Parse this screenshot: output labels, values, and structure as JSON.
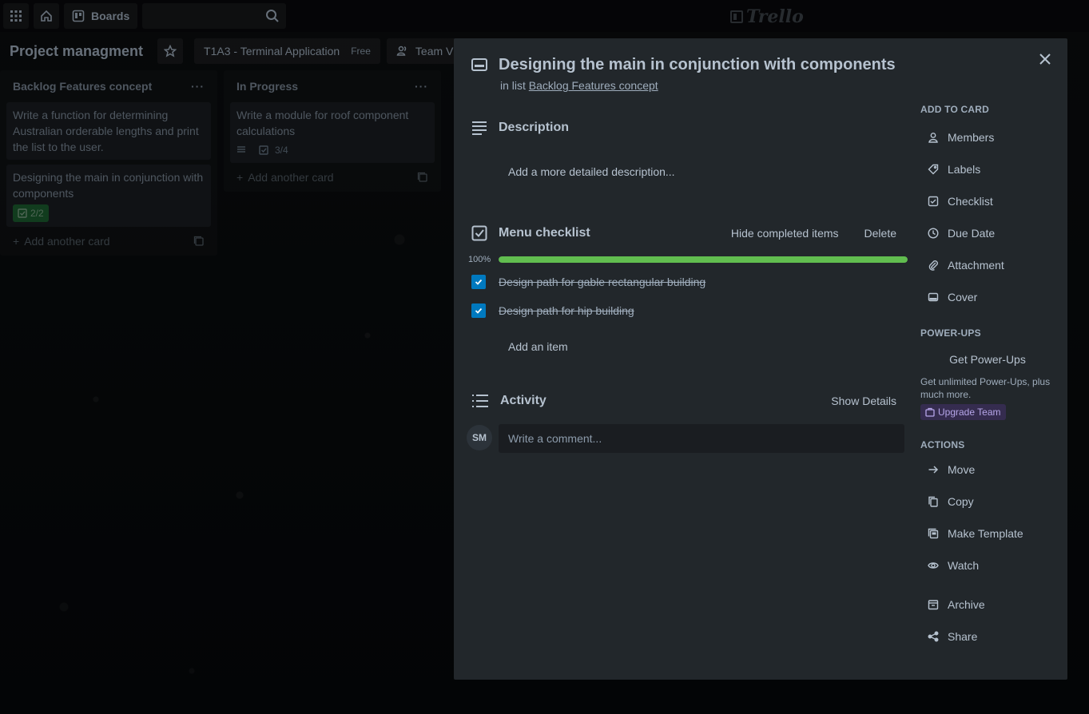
{
  "topbar": {
    "boards_label": "Boards",
    "logo_text": "Trello"
  },
  "board": {
    "title": "Project managment",
    "team_name": "T1A3 - Terminal Application",
    "team_plan": "Free",
    "visibility": "Team V"
  },
  "lists": [
    {
      "title": "Backlog Features concept",
      "cards": [
        {
          "text": "Write a function for determining Australian orderable lengths and print the list to the user."
        },
        {
          "text": "Designing the main in conjunction with components",
          "checklist": "2/2"
        }
      ],
      "add_card": "Add another card"
    },
    {
      "title": "In Progress",
      "cards": [
        {
          "text": "Write a module for roof component calculations",
          "checklist": "3/4"
        }
      ],
      "add_card": "Add another card"
    }
  ],
  "card_detail": {
    "title": "Designing the main in conjunction with components",
    "in_list_prefix": "in list",
    "list_name": "Backlog Features concept",
    "description": {
      "heading": "Description",
      "placeholder": "Add a more detailed description..."
    },
    "checklist": {
      "heading": "Menu checklist",
      "hide_completed": "Hide completed items",
      "delete": "Delete",
      "progress_label": "100%",
      "progress": 1.0,
      "items": [
        {
          "text": "Design path for gable rectangular building",
          "checked": true
        },
        {
          "text": "Design path for hip building",
          "checked": true
        }
      ],
      "add_item": "Add an item"
    },
    "activity": {
      "heading": "Activity",
      "show_details": "Show Details",
      "avatar_initials": "SM",
      "comment_placeholder": "Write a comment..."
    },
    "sidebar": {
      "add_to_card_heading": "ADD TO CARD",
      "add_to_card": [
        {
          "label": "Members",
          "icon": "person-icon"
        },
        {
          "label": "Labels",
          "icon": "tag-icon"
        },
        {
          "label": "Checklist",
          "icon": "checkbox-icon"
        },
        {
          "label": "Due Date",
          "icon": "clock-icon"
        },
        {
          "label": "Attachment",
          "icon": "paperclip-icon"
        },
        {
          "label": "Cover",
          "icon": "card-cover-icon"
        }
      ],
      "powerups_heading": "POWER-UPS",
      "get_powerups": "Get Power-Ups",
      "upgrade_text": "Get unlimited Power-Ups, plus much more.",
      "upgrade_button": "Upgrade Team",
      "actions_heading": "ACTIONS",
      "actions": [
        {
          "label": "Move",
          "icon": "arrow-right-icon"
        },
        {
          "label": "Copy",
          "icon": "copy-icon"
        },
        {
          "label": "Make Template",
          "icon": "template-icon"
        },
        {
          "label": "Watch",
          "icon": "eye-icon"
        },
        {
          "label": "Archive",
          "icon": "archive-icon"
        },
        {
          "label": "Share",
          "icon": "share-icon"
        }
      ]
    }
  },
  "colors": {
    "modal_bg": "#22272b",
    "progress_green": "#61bd4f",
    "checkbox_blue": "#0079bf",
    "upgrade_purple": "#352c4f"
  }
}
